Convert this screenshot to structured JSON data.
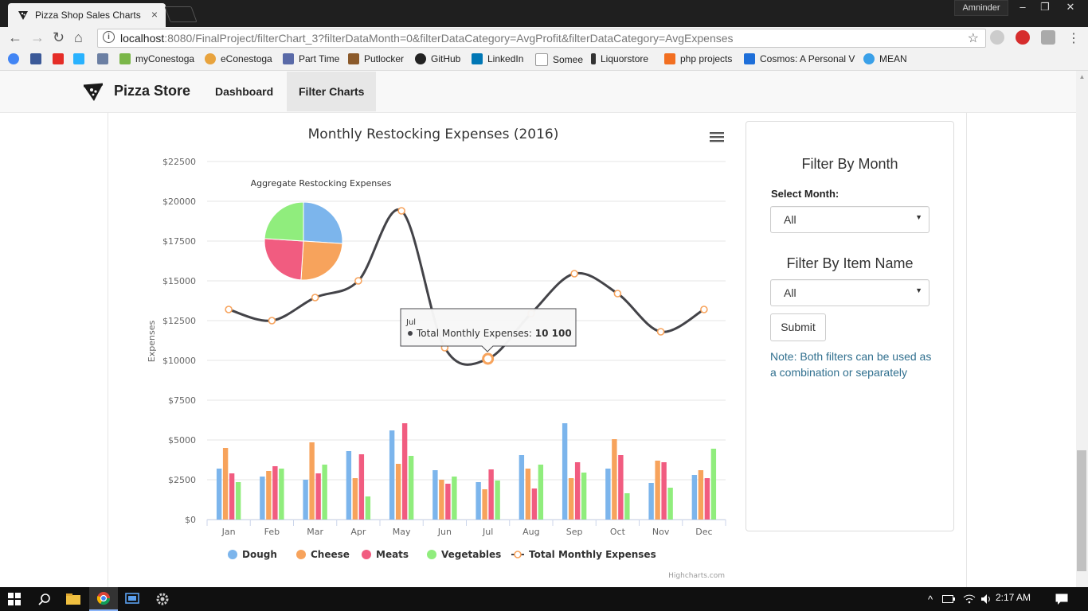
{
  "browser": {
    "tab_title": "Pizza Shop Sales Charts",
    "user": "Amninder",
    "url_host": "localhost",
    "url_path": ":8080/FinalProject/filterChart_3?filterDataMonth=0&filterDataCategory=AvgProfit&filterDataCategory=AvgExpenses",
    "bookmarks": [
      "myConestoga",
      "eConestoga",
      "Part Time",
      "Putlocker",
      "GitHub",
      "LinkedIn",
      "Somee",
      "Liquorstore",
      "php projects",
      "Cosmos: A Personal V",
      "MEAN"
    ]
  },
  "navbar": {
    "brand": "Pizza Store",
    "items": [
      {
        "label": "Dashboard"
      },
      {
        "label": "Filter Charts"
      }
    ]
  },
  "filters": {
    "month_heading": "Filter By Month",
    "month_label": "Select Month:",
    "month_value": "All",
    "item_heading": "Filter By Item Name",
    "item_value": "All",
    "submit_label": "Submit",
    "note": "Note: Both filters can be used as a combination or separately"
  },
  "taskbar": {
    "time": "2:17 AM"
  },
  "chart_data": {
    "type": "bar",
    "title": "Monthly Restocking Expenses (2016)",
    "ylabel": "Expenses",
    "xlabel": "",
    "ylim": [
      0,
      22500
    ],
    "ytick_labels": [
      "$0",
      "$2500",
      "$5000",
      "$7500",
      "$10000",
      "$12500",
      "$15000",
      "$17500",
      "$20000",
      "$22500"
    ],
    "categories": [
      "Jan",
      "Feb",
      "Mar",
      "Apr",
      "May",
      "Jun",
      "Jul",
      "Aug",
      "Sep",
      "Oct",
      "Nov",
      "Dec"
    ],
    "series": [
      {
        "name": "Dough",
        "type": "column",
        "color": "#7cb5ec",
        "values": [
          3200,
          2700,
          2500,
          4300,
          5600,
          3100,
          2350,
          4050,
          6050,
          3200,
          2300,
          2800
        ]
      },
      {
        "name": "Cheese",
        "type": "column",
        "color": "#f7a35c",
        "values": [
          4500,
          3050,
          4850,
          2600,
          3500,
          2500,
          1900,
          3200,
          2600,
          5050,
          3700,
          3100
        ]
      },
      {
        "name": "Meats",
        "type": "column",
        "color": "#f15c80",
        "values": [
          2900,
          3350,
          2900,
          4100,
          6050,
          2250,
          3150,
          1950,
          3600,
          4050,
          3600,
          2600
        ]
      },
      {
        "name": "Vegetables",
        "type": "column",
        "color": "#90ed7d",
        "values": [
          2350,
          3200,
          3450,
          1450,
          4000,
          2700,
          2450,
          3450,
          2950,
          1650,
          2000,
          4450
        ]
      },
      {
        "name": "Total Monthly Expenses",
        "type": "spline",
        "color": "#434348",
        "marker_color": "#f7a35c",
        "values": [
          13200,
          12500,
          13950,
          15000,
          19400,
          10800,
          10100,
          12950,
          15450,
          14200,
          11800,
          13200
        ]
      }
    ],
    "pie": {
      "title": "Aggregate Restocking Expenses",
      "slices": [
        {
          "name": "Dough",
          "percent": 26,
          "color": "#7cb5ec"
        },
        {
          "name": "Cheese",
          "percent": 25,
          "color": "#f7a35c"
        },
        {
          "name": "Meats",
          "percent": 25,
          "color": "#f15c80"
        },
        {
          "name": "Vegetables",
          "percent": 24,
          "color": "#90ed7d"
        }
      ]
    },
    "tooltip": {
      "category": "Jul",
      "series": "Total Monthly Expenses",
      "value": "10 100"
    },
    "credits": "Highcharts.com",
    "legend_position": "bottom",
    "grid": true
  }
}
